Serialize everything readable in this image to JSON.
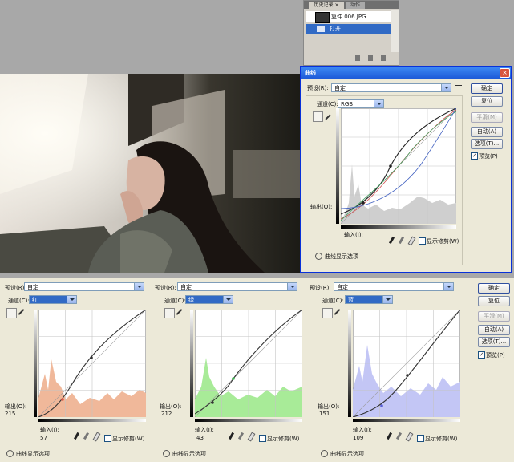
{
  "history": {
    "tab_active": "历史记录 ×",
    "tab_other": "动作",
    "snapshot_label": "复件 006.JPG",
    "step_label": "打开"
  },
  "curves_main": {
    "title": "曲线",
    "preset_label": "预设(R):",
    "preset_value": "自定",
    "channel_label": "通道(C):",
    "channel_value": "RGB",
    "output_label": "输出(O):",
    "input_label": "输入(I):",
    "show_clip": "显示修剪(W)",
    "display_options": "曲线显示选项",
    "buttons": {
      "ok": "确定",
      "reset": "复位",
      "smooth": "平滑(M)",
      "auto": "自动(A)",
      "options": "选项(T)...",
      "preview": "预览(P)"
    }
  },
  "curves_channels": {
    "preset_label": "预设(R):",
    "preset_value": "自定",
    "channel_label": "通道(C):",
    "output_label": "输出(O):",
    "input_label": "输入(I):",
    "show_clip": "显示修剪(W)",
    "display_options": "曲线显示选项",
    "panels": [
      {
        "channel": "红",
        "output": "215",
        "input": "57",
        "color": "#f0b89a",
        "line": "#e05a4a"
      },
      {
        "channel": "绿",
        "output": "212",
        "input": "43",
        "color": "#a8eb98",
        "line": "#3cb050"
      },
      {
        "channel": "蓝",
        "output": "151",
        "input": "109",
        "color": "#c3c6f5",
        "line": "#5860d8"
      }
    ],
    "buttons": {
      "ok": "确定",
      "reset": "复位",
      "smooth": "平滑(M)",
      "auto": "自动(A)",
      "options": "选项(T)...",
      "preview": "预览(P)"
    }
  },
  "colors": {
    "xp_title": "#2a64d8",
    "dialog_bg": "#ece9d8",
    "selection": "#316ac5"
  }
}
